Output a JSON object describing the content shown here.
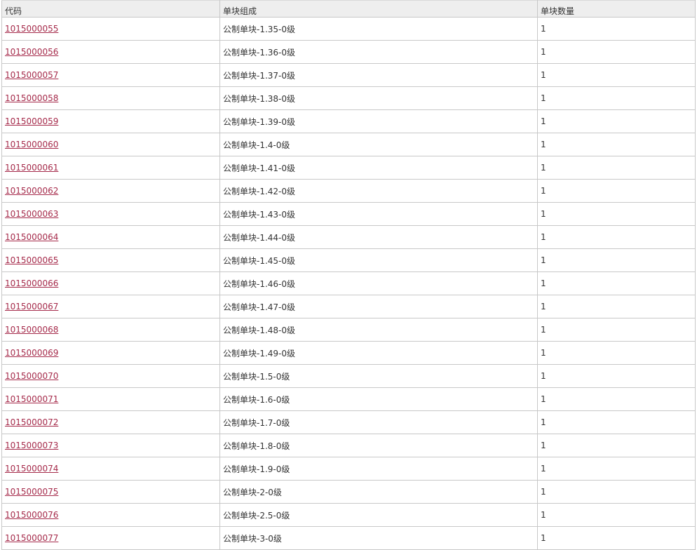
{
  "table": {
    "headers": {
      "code": "代码",
      "composition": "单块组成",
      "quantity": "单块数量"
    },
    "link_color": "#a52a4a",
    "rows": [
      {
        "code": "1015000055",
        "composition": "公制单块-1.35-0级",
        "quantity": "1"
      },
      {
        "code": "1015000056",
        "composition": "公制单块-1.36-0级",
        "quantity": "1"
      },
      {
        "code": "1015000057",
        "composition": "公制单块-1.37-0级",
        "quantity": "1"
      },
      {
        "code": "1015000058",
        "composition": "公制单块-1.38-0级",
        "quantity": "1"
      },
      {
        "code": "1015000059",
        "composition": "公制单块-1.39-0级",
        "quantity": "1"
      },
      {
        "code": "1015000060",
        "composition": "公制单块-1.4-0级",
        "quantity": "1"
      },
      {
        "code": "1015000061",
        "composition": "公制单块-1.41-0级",
        "quantity": "1"
      },
      {
        "code": "1015000062",
        "composition": "公制单块-1.42-0级",
        "quantity": "1"
      },
      {
        "code": "1015000063",
        "composition": "公制单块-1.43-0级",
        "quantity": "1"
      },
      {
        "code": "1015000064",
        "composition": "公制单块-1.44-0级",
        "quantity": "1"
      },
      {
        "code": "1015000065",
        "composition": "公制单块-1.45-0级",
        "quantity": "1"
      },
      {
        "code": "1015000066",
        "composition": "公制单块-1.46-0级",
        "quantity": "1"
      },
      {
        "code": "1015000067",
        "composition": "公制单块-1.47-0级",
        "quantity": "1"
      },
      {
        "code": "1015000068",
        "composition": "公制单块-1.48-0级",
        "quantity": "1"
      },
      {
        "code": "1015000069",
        "composition": "公制单块-1.49-0级",
        "quantity": "1"
      },
      {
        "code": "1015000070",
        "composition": "公制单块-1.5-0级",
        "quantity": "1"
      },
      {
        "code": "1015000071",
        "composition": "公制单块-1.6-0级",
        "quantity": "1"
      },
      {
        "code": "1015000072",
        "composition": "公制单块-1.7-0级",
        "quantity": "1"
      },
      {
        "code": "1015000073",
        "composition": "公制单块-1.8-0级",
        "quantity": "1"
      },
      {
        "code": "1015000074",
        "composition": "公制单块-1.9-0级",
        "quantity": "1"
      },
      {
        "code": "1015000075",
        "composition": "公制单块-2-0级",
        "quantity": "1"
      },
      {
        "code": "1015000076",
        "composition": "公制单块-2.5-0级",
        "quantity": "1"
      },
      {
        "code": "1015000077",
        "composition": "公制单块-3-0级",
        "quantity": "1"
      }
    ]
  }
}
